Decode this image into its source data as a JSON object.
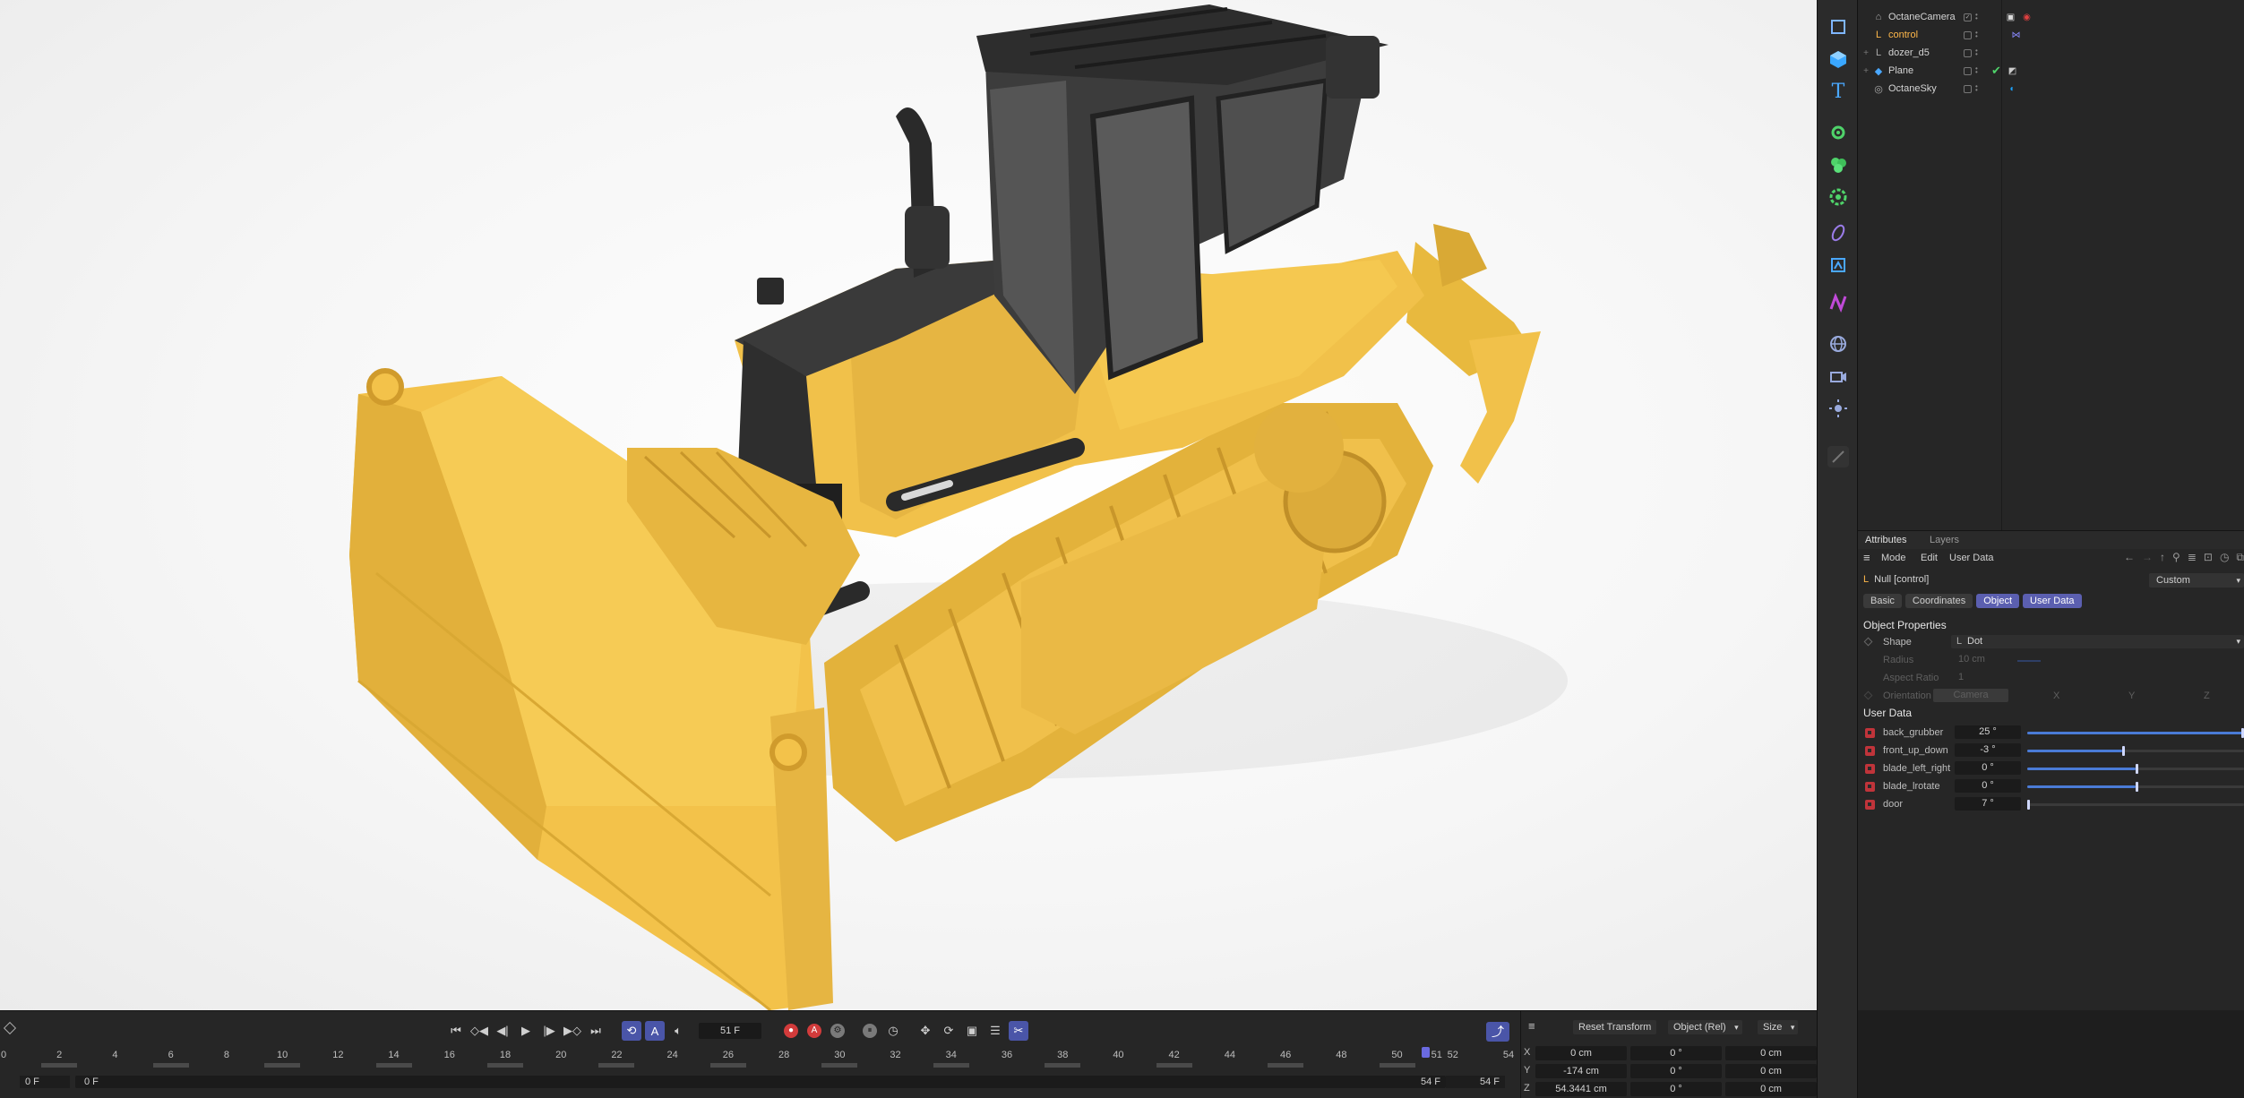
{
  "object_manager": {
    "objects": [
      {
        "name": "OctaneCamera",
        "icon": "camera-icon",
        "tag": "octane-camera-tag-icon",
        "tag_color": "#e04040",
        "selected": false,
        "expandable": false
      },
      {
        "name": "control",
        "icon": "null-icon",
        "tag": "xpresso-tag-icon",
        "tag_color": "#6a6ae0",
        "selected": true,
        "expandable": false
      },
      {
        "name": "dozer_d5",
        "icon": "null-icon",
        "tag": "",
        "tag_color": "",
        "selected": false,
        "expandable": true
      },
      {
        "name": "Plane",
        "icon": "plane-icon",
        "tag": "texture-tag-icon",
        "tag_color": "#cccccc",
        "selected": false,
        "expandable": true
      },
      {
        "name": "OctaneSky",
        "icon": "sky-icon",
        "tag": "octane-sky-tag-icon",
        "tag_color": "#1aa3ff",
        "selected": false,
        "expandable": false
      }
    ]
  },
  "attributes": {
    "tabs": [
      "Attributes",
      "Layers"
    ],
    "menu": [
      "Mode",
      "Edit",
      "User Data"
    ],
    "object_title": "Null [control]",
    "layout_preset": "Custom",
    "property_tabs": [
      {
        "label": "Basic",
        "active": false
      },
      {
        "label": "Coordinates",
        "active": false
      },
      {
        "label": "Object",
        "active": true
      },
      {
        "label": "User Data",
        "active": true
      }
    ],
    "object_properties_title": "Object Properties",
    "shape_label": "Shape",
    "shape_value": "Dot",
    "radius_label": "Radius",
    "radius_value": "10 cm",
    "aspect_label": "Aspect Ratio",
    "aspect_value": "1",
    "orientation_label": "Orientation",
    "orientation_value": "Camera",
    "orientation_axes": [
      "X",
      "Y",
      "Z"
    ],
    "user_data_title": "User Data",
    "user_data": [
      {
        "label": "back_grubber",
        "value": "25 °",
        "level": 1.0
      },
      {
        "label": "front_up_down",
        "value": "-3 °",
        "level": 0.44
      },
      {
        "label": "blade_left_right",
        "value": "0 °",
        "level": 0.5
      },
      {
        "label": "blade_lrotate",
        "value": "0 °",
        "level": 0.5
      },
      {
        "label": "door",
        "value": "7 °",
        "level": 0.0
      }
    ]
  },
  "timeline": {
    "current_frame": "51 F",
    "ticks": [
      "0",
      "2",
      "4",
      "6",
      "8",
      "10",
      "12",
      "14",
      "16",
      "18",
      "20",
      "22",
      "24",
      "26",
      "28",
      "30",
      "32",
      "34",
      "36",
      "38",
      "40",
      "42",
      "44",
      "46",
      "48",
      "50",
      "52",
      "54"
    ],
    "playhead_label": "51",
    "range_start": "0 F",
    "range_start_2": "0 F",
    "range_end": "54 F",
    "range_end_2": "54 F"
  },
  "coordinates": {
    "reset_label": "Reset Transform",
    "mode_label": "Object (Rel)",
    "size_label": "Size",
    "rows": [
      {
        "axis": "X",
        "pos": "0 cm",
        "rot": "0 °",
        "size": "0 cm"
      },
      {
        "axis": "Y",
        "pos": "-174 cm",
        "rot": "0 °",
        "size": "0 cm"
      },
      {
        "axis": "Z",
        "pos": "54.3441 cm",
        "rot": "0 °",
        "size": "0 cm"
      }
    ]
  },
  "colors": {
    "accent": "#5b5fb0",
    "selected_object": "#ffb84a",
    "dozer_yellow": "#f2c24a",
    "dozer_dark": "#2b2b2b"
  }
}
